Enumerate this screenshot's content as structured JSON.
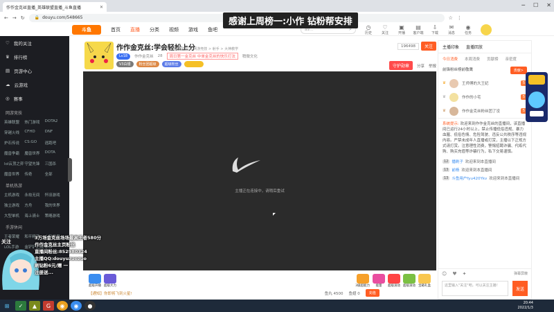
{
  "browser": {
    "tab_title": "作作金克丝直播_英雄联盟直播_斗鱼直播",
    "url": "douyu.com/548665"
  },
  "overlay": {
    "title": "感谢上周榜一:小作  钻粉帮安排",
    "attention": "关注",
    "lines": [
      "3万场金克丝场场最高王者580分",
      "作作金克丝主页粉丝",
      "直播间粉丝:852980324",
      "主播QQ:douyuzuozuo",
      "刷钻粉6元/赠 一",
      "注册送..."
    ]
  },
  "sidebar": {
    "items": [
      {
        "icon": "heart-icon",
        "label": "我的关注"
      },
      {
        "icon": "trophy-icon",
        "label": "排行榜"
      },
      {
        "icon": "page-icon",
        "label": "页游中心"
      },
      {
        "icon": "cloud-icon",
        "label": "云游戏"
      },
      {
        "icon": "match-icon",
        "label": "赛事"
      }
    ],
    "sections": [
      {
        "title": "网游竞技",
        "games": [
          "英雄联盟",
          "热门游戏",
          "DOTA2",
          "穿越火线",
          "CFHD",
          "DNF",
          "炉石传说",
          "CS:GO",
          "逃跑吧",
          "魔兽争霸",
          "魔兽世界",
          "DOTA",
          "lol云顶之弈",
          "守望先锋",
          "三国杀",
          "魔兽世界",
          "传奇",
          "全部"
        ]
      },
      {
        "title": "单机热游",
        "games": [
          "主机游戏",
          "永劫无间",
          "怀旧游戏",
          "独立游戏",
          "方舟",
          "我的世界",
          "大型单机",
          "海上骑士",
          "策略游戏"
        ]
      },
      {
        "title": "手游休闲",
        "games": [
          "王者荣耀",
          "和平精英",
          "火影忍者",
          "LOL手游",
          "金铲铲之战",
          "原神"
        ]
      }
    ]
  },
  "topnav": {
    "logo": "斗鱼",
    "links": [
      "首页",
      "直播",
      "分类",
      "视频",
      "游戏",
      "鱼吧"
    ],
    "active": "直播",
    "search_placeholder": "a9…",
    "icons": [
      {
        "name": "history-icon",
        "label": "历史"
      },
      {
        "name": "follow-icon",
        "label": "关注"
      },
      {
        "name": "open-live-icon",
        "label": "开播"
      },
      {
        "name": "client-icon",
        "label": "客户端"
      },
      {
        "name": "download-icon",
        "label": "下载"
      },
      {
        "name": "mail-icon",
        "label": "消息"
      },
      {
        "name": "task-icon",
        "label": "任务"
      }
    ]
  },
  "room": {
    "name": "作作金克丝:学会轻松上分",
    "level": "Lv18",
    "meta": [
      "作作金克丝",
      "28",
      "周日第一金克丝 中单金克丝的快乐打法",
      "稍微文化"
    ],
    "category": "英雄联盟 > 网游竞技 > 射手 > 大神教学",
    "tags": [
      "V3白银",
      "粉丝团超级",
      "超级粉丝",
      ""
    ],
    "fans_count": "196498",
    "follow_label": "关注",
    "hot_label": "守护勋章",
    "report_labels": [
      "分享",
      "举报"
    ]
  },
  "player": {
    "loading_text": "主播正在连接中，请稍后重试"
  },
  "giftbar": {
    "left_gifts": [
      "超级开播",
      "超级大力"
    ],
    "right_gifts": [
      "3级超能力",
      "能量",
      "超级滚动",
      "超级滚动",
      "宝箱礼盒"
    ],
    "bottom_text": "【通知】你即将飞到火星!",
    "bottom_stats": [
      "鱼丸 4500",
      "鱼翅 0",
      "充值"
    ]
  },
  "right_panel": {
    "tabs": [
      "主播印象",
      "直播回放"
    ],
    "sub_tabs": [
      "今日消费",
      "本周消费",
      "贡献榜",
      "亲密度"
    ],
    "rank_title": "前锋粉丝榜前敬鹰",
    "rank_more": "贡献>",
    "ranks": [
      {
        "name": "王师傅的大王妃",
        "badge": "5"
      },
      {
        "name": "作作的小宅",
        "badge": "5"
      },
      {
        "name": "作作金克丝粉丝团了没",
        "badge": "5"
      }
    ],
    "system_msg_label": "系统提示:",
    "system_msg": "欢迎来到作作金克丝的直播间，该直播间已运行24小时以上，禁止传播低俗违规、暴力血腥、低俗色情、危险驾驶、违反公共秩序等违规内容。严禁未成年人直播或打赏，主播以下正规方式请打赏。注意理性消费，警惕招聘诈骗、代练代购、购买充值等诈骗行为，私下交易谨慎。",
    "chats": [
      {
        "lv": "12",
        "user": "播刷子",
        "msg": "欢迎来到本直播间"
      },
      {
        "lv": "13",
        "user": "前杨",
        "msg": "欢迎来到本直播间"
      },
      {
        "lv": "13",
        "user": "斗鱼用户fyu420Ykv",
        "msg": "欢迎来到本直播间"
      }
    ],
    "danmaku_toggle": "弹幕屏蔽",
    "chat_placeholder": "这里输入\"关注\"吧，可以关注主播！",
    "send_label": "发送"
  },
  "taskbar": {
    "time": "20:44",
    "date": "2022/1/3"
  }
}
